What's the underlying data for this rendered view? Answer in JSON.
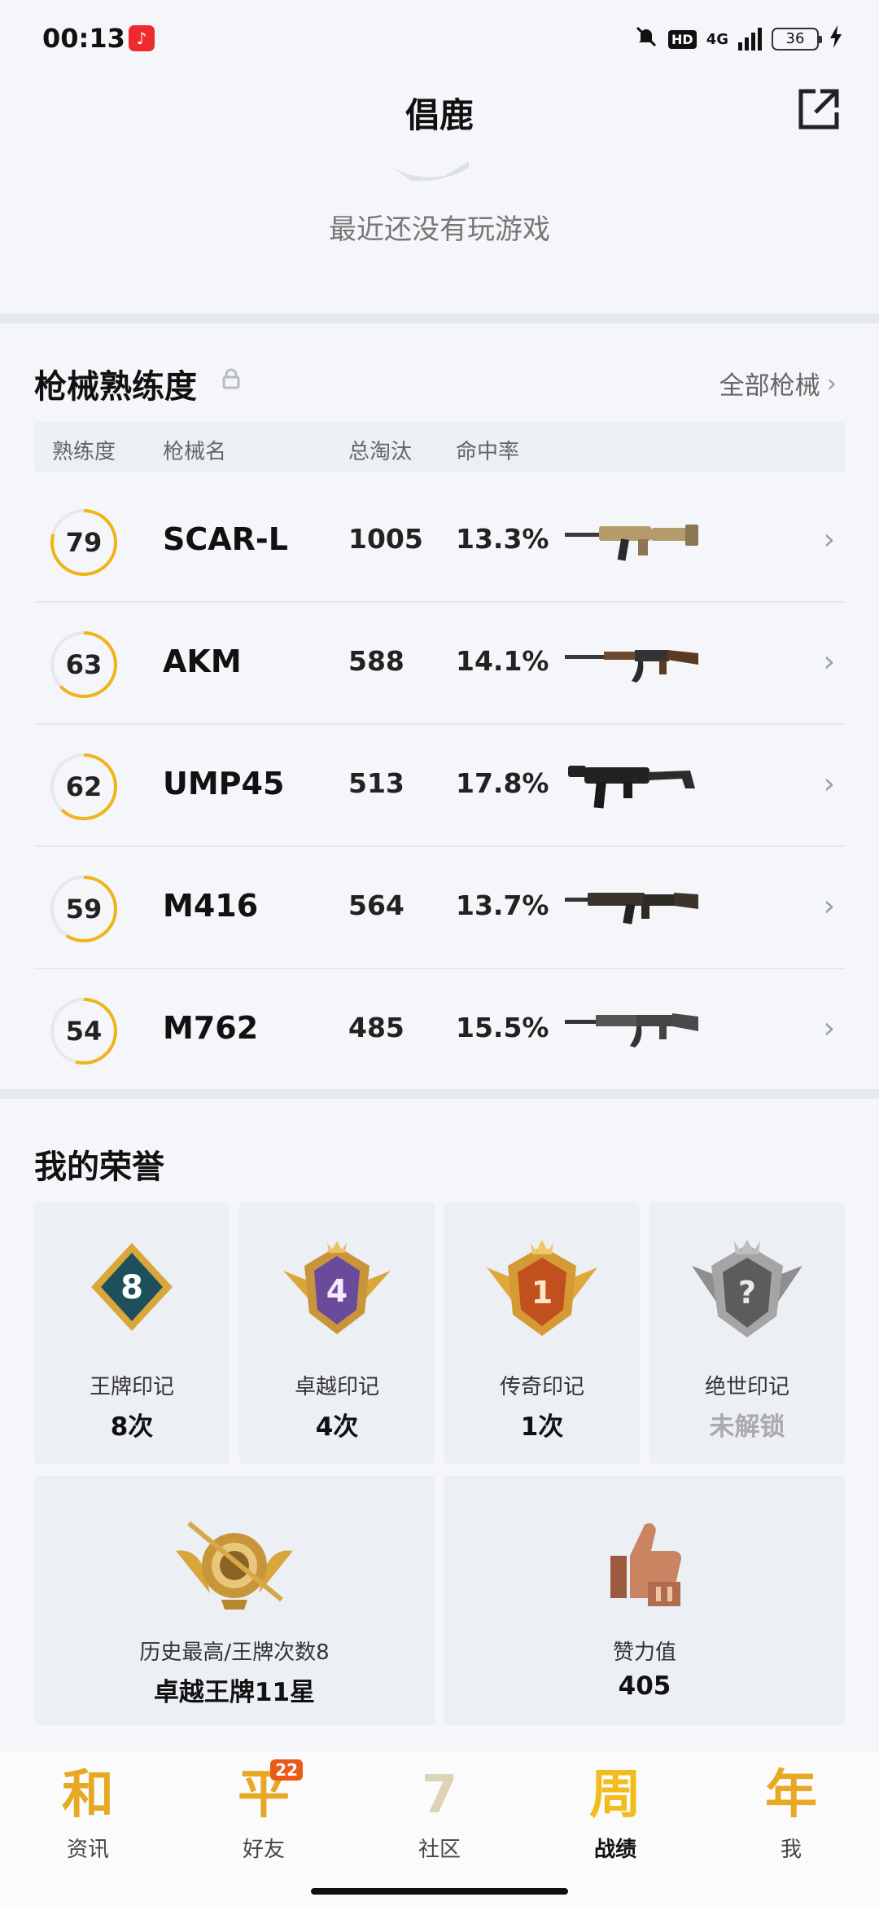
{
  "status_bar": {
    "time": "00:13",
    "network": "4G",
    "hd": "HD",
    "battery": "36",
    "icons": [
      "music-app-icon",
      "mute-bell-icon",
      "signal-icon",
      "battery-icon",
      "charging-icon"
    ]
  },
  "header": {
    "title": "倡鹿",
    "share_icon": "share-external-icon"
  },
  "recent": {
    "empty_text": "最近还没有玩游戏"
  },
  "weapons": {
    "title": "枪械熟练度",
    "all_link": "全部枪械",
    "columns": [
      "熟练度",
      "枪械名",
      "总淘汰",
      "命中率"
    ],
    "rows": [
      {
        "proficiency": "79",
        "name": "SCAR-L",
        "kills": "1005",
        "accuracy": "13.3%",
        "ring_fraction": 0.79,
        "gun_color": "#b59a6b"
      },
      {
        "proficiency": "63",
        "name": "AKM",
        "kills": "588",
        "accuracy": "14.1%",
        "ring_fraction": 0.63,
        "gun_color": "#5b3a24"
      },
      {
        "proficiency": "62",
        "name": "UMP45",
        "kills": "513",
        "accuracy": "17.8%",
        "ring_fraction": 0.62,
        "gun_color": "#222222"
      },
      {
        "proficiency": "59",
        "name": "M416",
        "kills": "564",
        "accuracy": "13.7%",
        "ring_fraction": 0.59,
        "gun_color": "#3a342c"
      },
      {
        "proficiency": "54",
        "name": "M762",
        "kills": "485",
        "accuracy": "15.5%",
        "ring_fraction": 0.54,
        "gun_color": "#4a4a4a"
      }
    ]
  },
  "honors": {
    "title": "我的荣誉",
    "cards": [
      {
        "label": "王牌印记",
        "value": "8次",
        "badge_number": "8",
        "icon": "ace-emblem-icon"
      },
      {
        "label": "卓越印记",
        "value": "4次",
        "badge_number": "4",
        "icon": "excellence-emblem-icon"
      },
      {
        "label": "传奇印记",
        "value": "1次",
        "badge_number": "1",
        "icon": "legend-emblem-icon"
      },
      {
        "label": "绝世印记",
        "value": "未解锁",
        "badge_number": "?",
        "icon": "peerless-emblem-icon"
      }
    ],
    "wide_cards": [
      {
        "label": "历史最高/王牌次数8",
        "value": "卓越王牌11星",
        "icon": "rank-crest-icon"
      },
      {
        "label": "赞力值",
        "value": "405",
        "icon": "thumbs-up-icon"
      }
    ]
  },
  "nav": {
    "items": [
      {
        "label": "资讯",
        "glyph": "和",
        "active": false
      },
      {
        "label": "好友",
        "glyph": "平",
        "badge": "22",
        "active": false
      },
      {
        "label": "社区",
        "glyph": "7",
        "active": false
      },
      {
        "label": "战绩",
        "glyph": "周",
        "active": true
      },
      {
        "label": "我",
        "glyph": "年",
        "active": false
      }
    ]
  },
  "colors": {
    "accent": "#f2b318",
    "ring_track": "#e6e8eb",
    "page_bg": "#f4f6f9"
  }
}
